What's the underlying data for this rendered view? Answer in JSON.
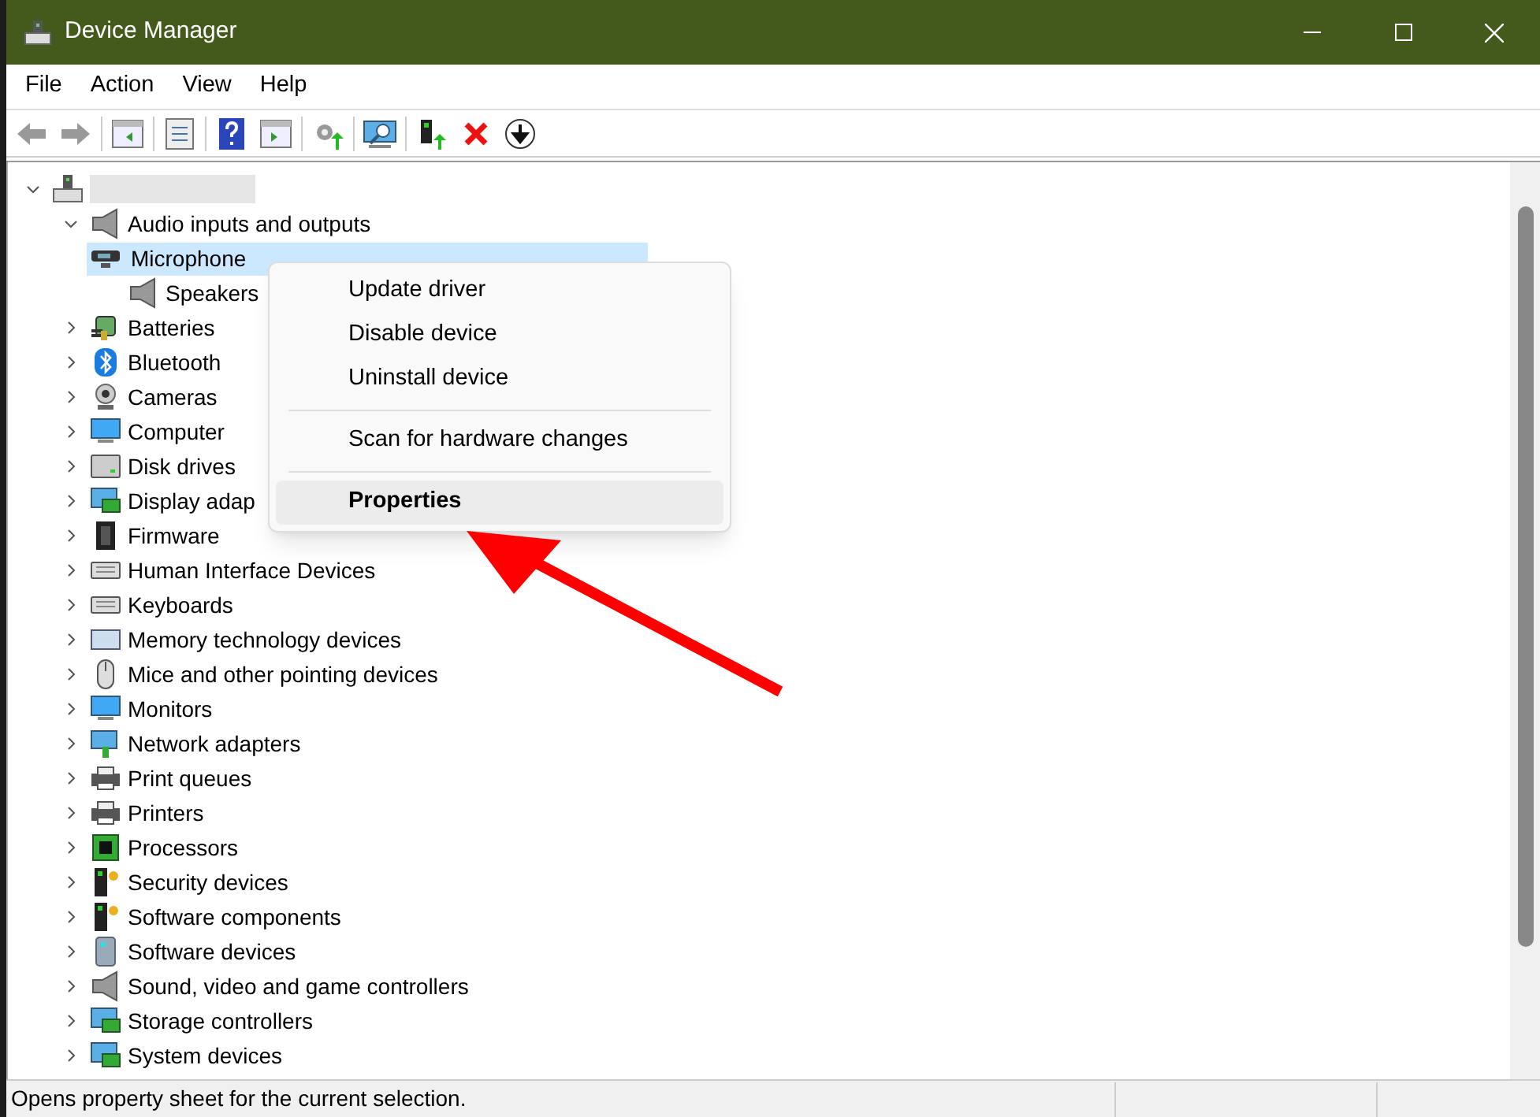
{
  "window": {
    "title": "Device Manager"
  },
  "menu_bar": [
    "File",
    "Action",
    "View",
    "Help"
  ],
  "tree": {
    "expanded": true,
    "selected": false,
    "children": [
      {
        "label": "Audio inputs and outputs",
        "expanded": true,
        "selected": false,
        "children": [
          {
            "label": "Microphone",
            "selected": true
          },
          {
            "label": "Speakers",
            "selected": false
          }
        ]
      },
      {
        "label": "Batteries",
        "expanded": false,
        "selected": false
      },
      {
        "label": "Bluetooth",
        "expanded": false,
        "selected": false
      },
      {
        "label": "Cameras",
        "expanded": false,
        "selected": false
      },
      {
        "label": "Computer",
        "expanded": false,
        "selected": false
      },
      {
        "label": "Disk drives",
        "expanded": false,
        "selected": false
      },
      {
        "label": "Display adap",
        "expanded": false,
        "selected": false
      },
      {
        "label": "Firmware",
        "expanded": false,
        "selected": false
      },
      {
        "label": "Human Interface Devices",
        "expanded": false,
        "selected": false
      },
      {
        "label": "Keyboards",
        "expanded": false,
        "selected": false
      },
      {
        "label": "Memory technology devices",
        "expanded": false,
        "selected": false
      },
      {
        "label": "Mice and other pointing devices",
        "expanded": false,
        "selected": false
      },
      {
        "label": "Monitors",
        "expanded": false,
        "selected": false
      },
      {
        "label": "Network adapters",
        "expanded": false,
        "selected": false
      },
      {
        "label": "Print queues",
        "expanded": false,
        "selected": false
      },
      {
        "label": "Printers",
        "expanded": false,
        "selected": false
      },
      {
        "label": "Processors",
        "expanded": false,
        "selected": false
      },
      {
        "label": "Security devices",
        "expanded": false,
        "selected": false
      },
      {
        "label": "Software components",
        "expanded": false,
        "selected": false
      },
      {
        "label": "Software devices",
        "expanded": false,
        "selected": false
      },
      {
        "label": "Sound, video and game controllers",
        "expanded": false,
        "selected": false
      },
      {
        "label": "Storage controllers",
        "expanded": false,
        "selected": false
      },
      {
        "label": "System devices",
        "expanded": false,
        "selected": false
      }
    ]
  },
  "context_menu": [
    {
      "kind": "item",
      "label": "Update driver",
      "default": false,
      "highlighted": false
    },
    {
      "kind": "item",
      "label": "Disable device",
      "default": false,
      "highlighted": false
    },
    {
      "kind": "item",
      "label": "Uninstall device",
      "default": false,
      "highlighted": false
    },
    {
      "kind": "separator"
    },
    {
      "kind": "item",
      "label": "Scan for hardware changes",
      "default": false,
      "highlighted": false
    },
    {
      "kind": "separator"
    },
    {
      "kind": "item",
      "label": "Properties",
      "default": true,
      "highlighted": true
    }
  ],
  "status_bar": {
    "text": "Opens property sheet for the current selection."
  }
}
